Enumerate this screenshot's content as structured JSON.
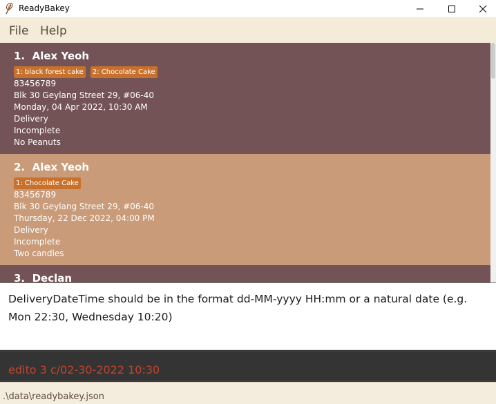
{
  "window": {
    "title": "ReadyBakey",
    "app_icon": "whisk-icon",
    "controls": [
      "minimize-icon",
      "maximize-icon",
      "close-icon"
    ]
  },
  "menu": {
    "file": "File",
    "help": "Help"
  },
  "orders": [
    {
      "index": "1.",
      "name": "Alex Yeoh",
      "tags": [
        "1: black forest cake",
        "2: Chocolate Cake"
      ],
      "phone": "83456789",
      "address": "Blk 30 Geylang Street 29, #06-40",
      "datetime": "Monday, 04 Apr 2022, 10:30 AM",
      "delivery": "Delivery",
      "status": "Incomplete",
      "remark": "No Peanuts"
    },
    {
      "index": "2.",
      "name": "Alex Yeoh",
      "tags": [
        "1: Chocolate Cake"
      ],
      "phone": "83456789",
      "address": "Blk 30 Geylang Street 29, #06-40",
      "datetime": "Thursday, 22 Dec 2022, 04:00 PM",
      "delivery": "Delivery",
      "status": "Incomplete",
      "remark": "Two candles"
    },
    {
      "index": "3.",
      "name": "Declan"
    }
  ],
  "result": {
    "message": "DeliveryDateTime should be in the format dd-MM-yyyy HH:mm or a natural date (e.g. Mon 22:30, Wednesday 10:20)"
  },
  "command": {
    "value": "edito 3 c/02-30-2022 10:30",
    "error_color": "#c2442e"
  },
  "status_bar": {
    "path": ".\\data\\readybakey.json"
  },
  "colors": {
    "card_dark": "#735356",
    "card_light": "#c99b79",
    "tag": "#c8712d",
    "menu_bg": "#f4ebd9"
  }
}
